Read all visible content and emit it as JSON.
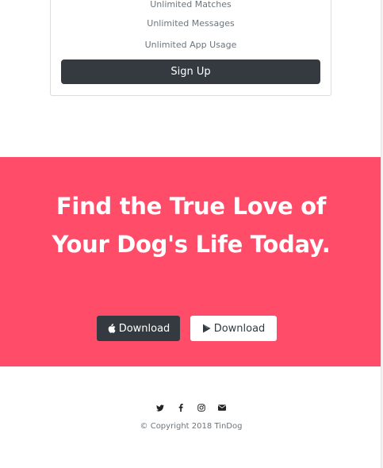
{
  "pricing": {
    "features": [
      "Unlimited Matches",
      "Unlimited Messages",
      "Unlimited App Usage"
    ],
    "signup_label": "Sign Up"
  },
  "cta": {
    "title": "Find the True Love of Your Dog's Life Today.",
    "apple_label": "Download",
    "google_label": "Download"
  },
  "footer": {
    "social_icons": [
      "twitter-icon",
      "facebook-icon",
      "instagram-icon",
      "envelope-icon"
    ],
    "copyright": "© Copyright 2018 TinDog"
  },
  "colors": {
    "brand": "#ff4c68",
    "dark": "#343a40"
  }
}
